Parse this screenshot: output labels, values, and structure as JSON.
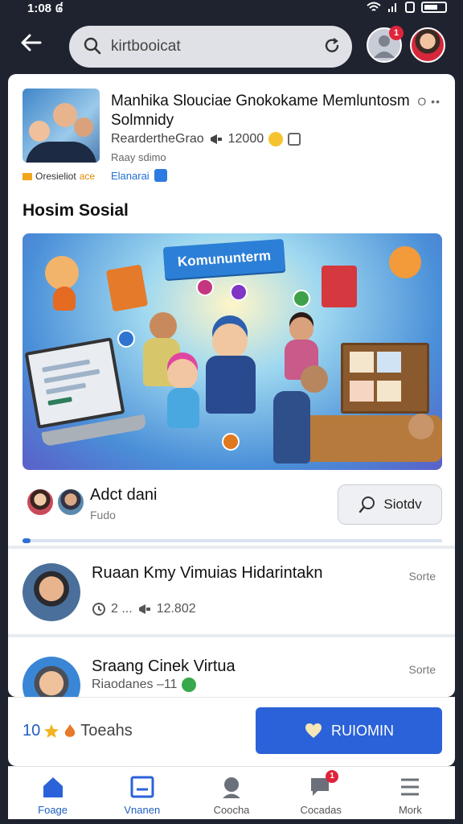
{
  "status_bar": {
    "time": "1:08 ៨"
  },
  "search": {
    "value": "kirtbooicat",
    "placeholder": "kirtbooicat"
  },
  "notifications": {
    "count": "1"
  },
  "group": {
    "title": "Manhika Slouciae  Gnokokame Memluntosm Solmnidy",
    "meta_name": "ReardertheGrao",
    "meta_count": "12000",
    "sub": "Raay sdimo",
    "tag1": "Oresieliot",
    "tag1_extra": "ace",
    "tag2": "Elanarai",
    "more": "O ••"
  },
  "section_title": "Hosim Sosial",
  "banner": {
    "ribbon_text": "Komununterm"
  },
  "feature": {
    "title": "Adct dani",
    "subtitle": "Fudo",
    "button_label": "Siotdv",
    "progress": 0.02
  },
  "posts": [
    {
      "title": "Ruaan Kmy Vimuias Hidarintakn",
      "meta_a": "2 ...",
      "meta_b": "12.802",
      "right": "Sorte",
      "avatar_color": "#4a7fb8"
    },
    {
      "title": "Sraang Cinek Virtua",
      "meta_a": "Riaodanes –11",
      "meta_b": "",
      "right": "Sorte",
      "avatar_color": "#3a86d6"
    }
  ],
  "action_bar": {
    "stat_value": "10",
    "stat_label": "Toeahs",
    "cta_label": "RUIOMIN"
  },
  "nav": [
    {
      "label": "Foage",
      "icon": "home-icon",
      "active": true
    },
    {
      "label": "Vnanen",
      "icon": "board-icon",
      "active": true
    },
    {
      "label": "Coocha",
      "icon": "people-icon",
      "active": false
    },
    {
      "label": "Cocadas",
      "icon": "chat-icon",
      "active": false,
      "badge": "1"
    },
    {
      "label": "Mork",
      "icon": "menu-icon",
      "active": false
    }
  ],
  "colors": {
    "accent": "#2b62d9",
    "badge": "#e0243a",
    "background": "#1f2330"
  }
}
